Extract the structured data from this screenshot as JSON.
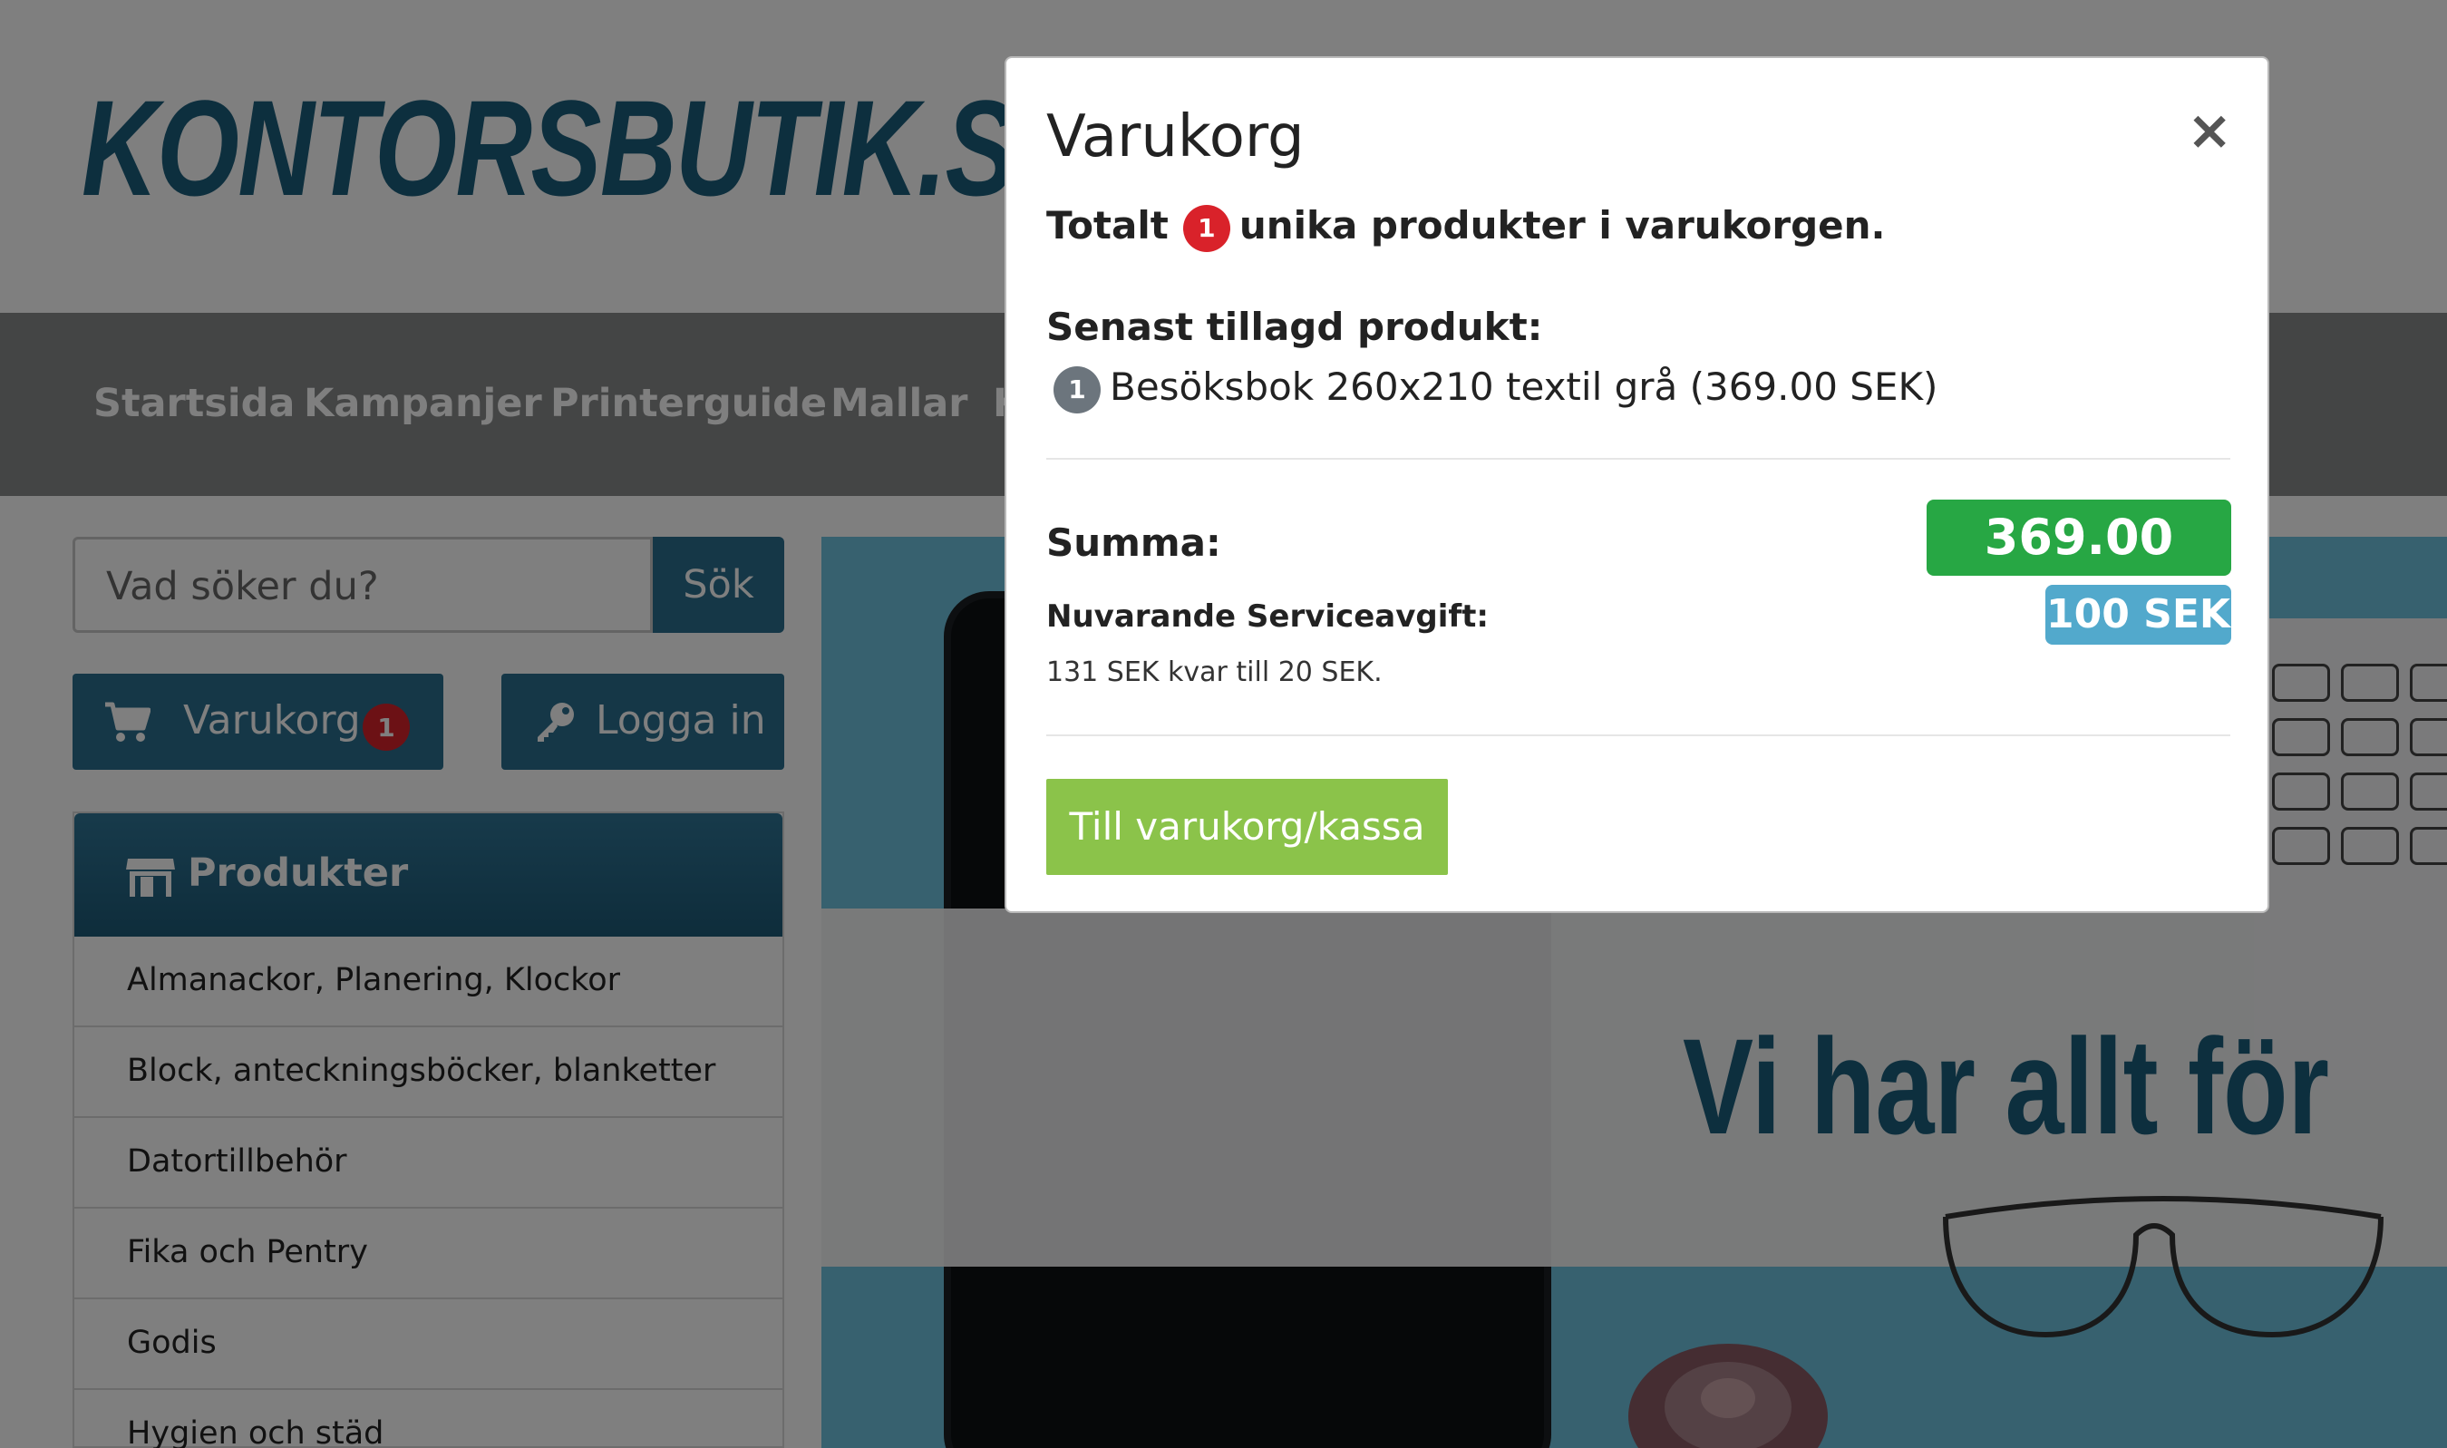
{
  "header": {
    "logo_text": "KONTORSBUTIK.SE"
  },
  "nav": {
    "items": [
      "Startsida",
      "Kampanjer",
      "Printerguide",
      "Mallar",
      "K"
    ]
  },
  "search": {
    "placeholder": "Vad söker du?",
    "button_label": "Sök"
  },
  "cart_button": {
    "label": "Varukorg",
    "count": "1"
  },
  "login_button": {
    "label": "Logga in"
  },
  "products": {
    "title": "Produkter",
    "categories": [
      "Almanackor, Planering, Klockor",
      "Block, anteckningsböcker, blanketter",
      "Datortillbehör",
      "Fika och Pentry",
      "Godis",
      "Hygien och städ"
    ]
  },
  "hero": {
    "tagline": "Vi har allt för"
  },
  "modal": {
    "title": "Varukorg",
    "close_symbol": "×",
    "total_prefix": "Totalt",
    "total_count": "1",
    "total_suffix": "unika produkter i varukorgen.",
    "latest_label": "Senast tillagd produkt:",
    "latest_qty": "1",
    "latest_product": "Besöksbok 260x210 textil grå (369.00 SEK)",
    "sum_label": "Summa:",
    "sum_value": "369.00 SEK",
    "fee_label": "Nuvarande Serviceavgift:",
    "fee_value": "100 SEK",
    "fee_note": "131 SEK kvar till 20 SEK.",
    "checkout_label": "Till varukorg/kassa"
  },
  "colors": {
    "brand": "#1b5e7c",
    "primary_button": "#2b6f8e",
    "badge_red": "#d9222a",
    "sum_green": "#27a744",
    "fee_blue": "#52a9cc",
    "checkout_green": "#8bc34a"
  },
  "icons": [
    "cart-icon",
    "key-icon",
    "shop-icon",
    "close-icon"
  ]
}
